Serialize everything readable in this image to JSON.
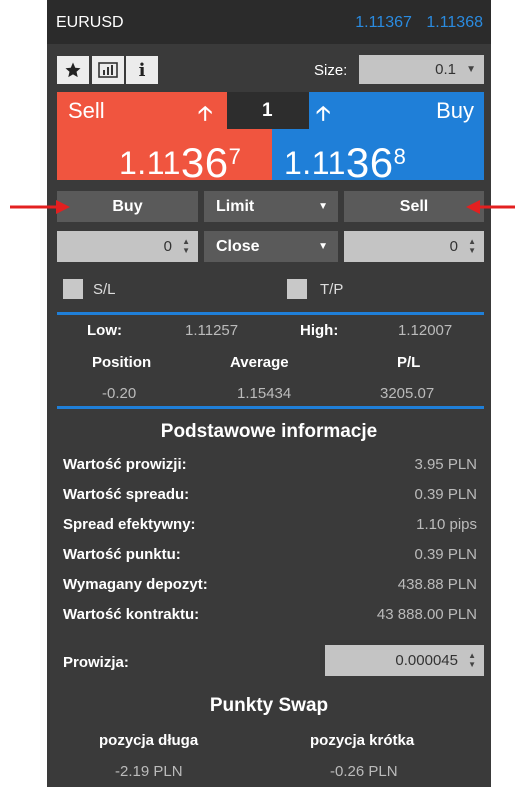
{
  "header": {
    "symbol": "EURUSD",
    "bid": "1.11367",
    "ask": "1.11368",
    "accent_color": "#1f7fd8"
  },
  "toolbar": {
    "favorite_icon": "star-icon",
    "chart_icon": "chart-icon",
    "info_icon": "info-icon",
    "info_glyph": "i",
    "size_label": "Size:",
    "size_value": "0.1"
  },
  "quote": {
    "sell_label": "Sell",
    "buy_label": "Buy",
    "lots": "1",
    "sell_price_prefix": "1.11",
    "sell_price_big": "36",
    "sell_price_pip": "7",
    "buy_price_prefix": "1.11",
    "buy_price_big": "36",
    "buy_price_pip": "8",
    "sell_color": "#f0553f",
    "buy_color": "#1f7fd8"
  },
  "order": {
    "buy_label": "Buy",
    "type_label": "Limit",
    "sell_label": "Sell",
    "buy_qty": "0",
    "close_label": "Close",
    "sell_qty": "0"
  },
  "protection": {
    "sl_label": "S/L",
    "tp_label": "T/P"
  },
  "stats": {
    "low_label": "Low:",
    "low_value": "1.11257",
    "high_label": "High:",
    "high_value": "1.12007",
    "position_label": "Position",
    "average_label": "Average",
    "pl_label": "P/L",
    "position_value": "-0.20",
    "average_value": "1.15434",
    "pl_value": "3205.07"
  },
  "info": {
    "title": "Podstawowe informacje",
    "rows": [
      {
        "label": "Wartość prowizji:",
        "value": "3.95 PLN"
      },
      {
        "label": "Wartość spreadu:",
        "value": "0.39 PLN"
      },
      {
        "label": "Spread efektywny:",
        "value": "1.10 pips"
      },
      {
        "label": "Wartość punktu:",
        "value": "0.39 PLN"
      },
      {
        "label": "Wymagany depozyt:",
        "value": "438.88 PLN"
      },
      {
        "label": "Wartość kontraktu:",
        "value": "43 888.00 PLN"
      }
    ],
    "commission_label": "Prowizja:",
    "commission_value": "0.000045"
  },
  "swap": {
    "title": "Punkty Swap",
    "long_label": "pozycja długa",
    "short_label": "pozycja krótka",
    "long_value": "-2.19 PLN",
    "short_value": "-0.26 PLN"
  }
}
